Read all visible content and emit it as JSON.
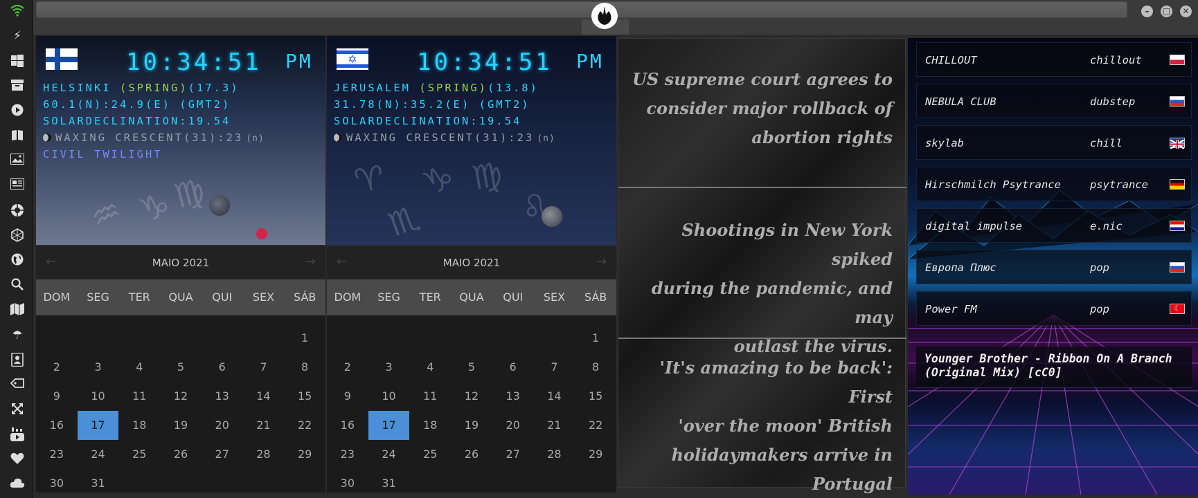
{
  "sidebar": {
    "icons": [
      "wifi-icon",
      "lightning-icon",
      "windows-icon",
      "archive-icon",
      "play-icon",
      "book-icon",
      "image-icon",
      "news-icon",
      "rebel-icon",
      "hexagon-icon",
      "globe-icon",
      "search-icon",
      "map-icon",
      "umbrella-icon",
      "contacts-icon",
      "tag-icon",
      "expand-icon",
      "youtube-icon",
      "heart-icon",
      "cloud-icon"
    ]
  },
  "clocks": [
    {
      "flag": "finland",
      "time": "10:34:51",
      "ampm": "PM",
      "city_prefix": "HELSINKI ",
      "season": "(SPRING)",
      "city_suffix": "(17.3)",
      "coords": "60.1(N):24.9(E) (GMT2)",
      "solar": "SOLARDECLINATION:19.54",
      "moon": "WAXING CRESCENT(31):23",
      "moon_suffix": "(n)",
      "twilight": "CIVIL TWILIGHT"
    },
    {
      "flag": "israel",
      "time": "10:34:51",
      "ampm": "PM",
      "city_prefix": "JERUSALEM ",
      "season": "(SPRING)",
      "city_suffix": "(13.8)",
      "coords": "31.78(N):35.2(E) (GMT2)",
      "solar": "SOLARDECLINATION:19.54",
      "moon": "WAXING CRESCENT(31):23",
      "moon_suffix": "(n)",
      "twilight": ""
    }
  ],
  "calendars": [
    {
      "title": "MAIO 2021",
      "prev": "←",
      "next": "→",
      "dow": [
        "DOM",
        "SEG",
        "TER",
        "QUA",
        "QUI",
        "SEX",
        "SÁB"
      ],
      "offset": 6,
      "days": 31,
      "selected": 17
    },
    {
      "title": "MAIO 2021",
      "prev": "←",
      "next": "→",
      "dow": [
        "DOM",
        "SEG",
        "TER",
        "QUA",
        "QUI",
        "SEX",
        "SÁB"
      ],
      "offset": 6,
      "days": 31,
      "selected": 17
    }
  ],
  "news": [
    {
      "lines": [
        "US supreme court agrees to",
        "consider major rollback of",
        "abortion rights"
      ]
    },
    {
      "lines": [
        "Shootings in New York spiked",
        "during the pandemic, and may",
        "outlast the virus."
      ]
    },
    {
      "lines": [
        "'It's amazing to be back': First",
        "'over the moon' British",
        "holidaymakers arrive in",
        "Portugal"
      ]
    }
  ],
  "radio": {
    "stations": [
      {
        "name": "CHILLOUT",
        "genre": "chillout",
        "flag": "poland"
      },
      {
        "name": "NEBULA CLUB",
        "genre": "dubstep",
        "flag": "russia"
      },
      {
        "name": "skylab",
        "genre": "chill",
        "flag": "uk"
      },
      {
        "name": "Hirschmilch Psytrance",
        "genre": "psytrance",
        "flag": "germany"
      },
      {
        "name": "digital impulse",
        "genre": "e.nic",
        "flag": "croatia"
      },
      {
        "name": "Европа Плюс",
        "genre": "pop",
        "flag": "russia"
      },
      {
        "name": "Power FM",
        "genre": "pop",
        "flag": "turkey"
      }
    ],
    "now_playing": "Younger Brother - Ribbon On A Branch (Original Mix) [cC0]"
  },
  "colors": {
    "clock_cyan": "#27d3ff",
    "season_green": "#9cd04a",
    "twilight_blue": "#6d8cff",
    "calendar_selected": "#4a8fd8"
  }
}
